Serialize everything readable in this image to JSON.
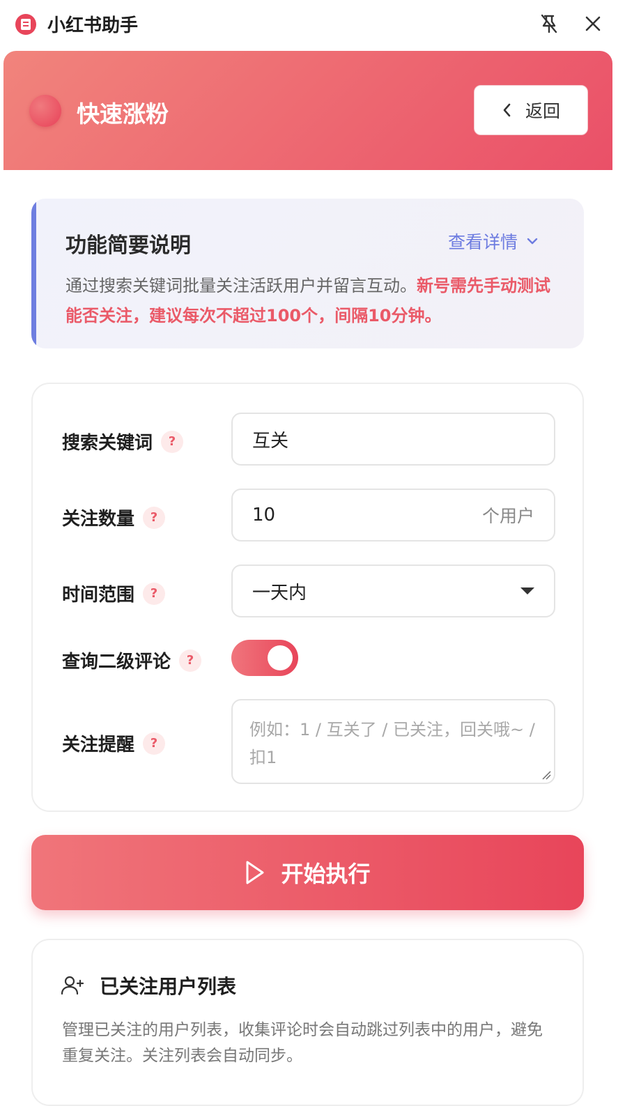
{
  "app": {
    "title": "小红书助手"
  },
  "header": {
    "title": "快速涨粉",
    "back_label": "返回"
  },
  "intro": {
    "title": "功能简要说明",
    "link": "查看详情",
    "desc_normal": "通过搜索关键词批量关注活跃用户并留言互动。",
    "desc_warning": "新号需先手动测试能否关注，建议每次不超过100个，间隔10分钟。"
  },
  "form": {
    "keyword": {
      "label": "搜索关键词",
      "value": "互关"
    },
    "count": {
      "label": "关注数量",
      "value": "10",
      "suffix": "个用户"
    },
    "time_range": {
      "label": "时间范围",
      "value": "一天内"
    },
    "sub_comments": {
      "label": "查询二级评论",
      "enabled": true
    },
    "reminder": {
      "label": "关注提醒",
      "placeholder": "例如：1 / 互关了 / 已关注，回关哦~ / 扣1"
    },
    "help_glyph": "?"
  },
  "start_button": {
    "label": "开始执行"
  },
  "followed_list": {
    "title": "已关注用户列表",
    "desc": "管理已关注的用户列表，收集评论时会自动跳过列表中的用户，避免重复关注。关注列表会自动同步。"
  },
  "colors": {
    "accent": "#e8455a",
    "accent_light": "#f1847c",
    "link": "#6d7ce0"
  }
}
